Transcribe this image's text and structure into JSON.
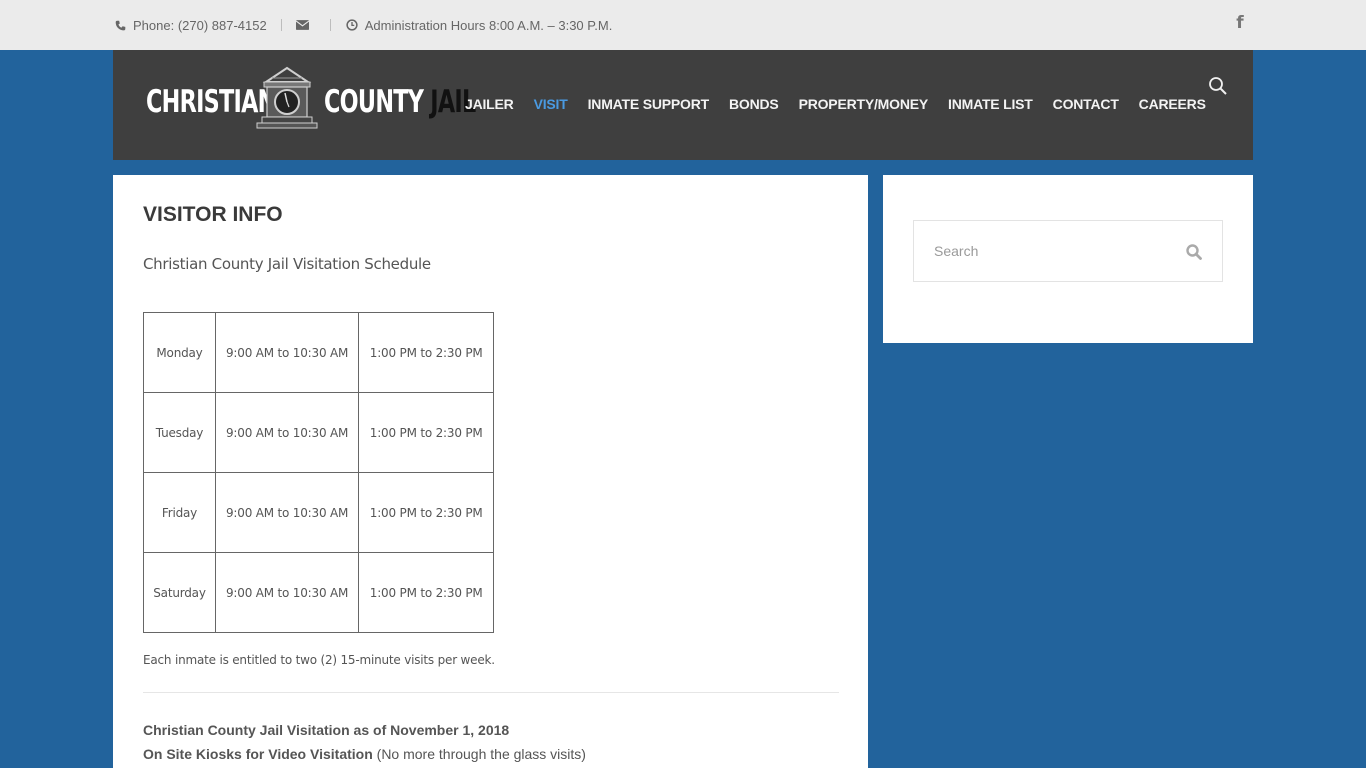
{
  "topbar": {
    "phone": "Phone: (270) 887-4152",
    "hours": "Administration Hours 8:00 A.M. – 3:30 P.M.",
    "icons": {
      "phone": "phone-icon",
      "email": "envelope-icon",
      "clock": "clock-icon",
      "social": "facebook-icon"
    },
    "facebook_glyph": "f"
  },
  "header": {
    "logo": {
      "left": "CHRISTIAN",
      "county": "COUNTY",
      "jail": "JAIL"
    },
    "nav": [
      {
        "label": "JAILER",
        "active": false
      },
      {
        "label": "VISIT",
        "active": true
      },
      {
        "label": "INMATE SUPPORT",
        "active": false
      },
      {
        "label": "BONDS",
        "active": false
      },
      {
        "label": "PROPERTY/MONEY",
        "active": false
      },
      {
        "label": "INMATE LIST",
        "active": false
      },
      {
        "label": "CONTACT",
        "active": false
      },
      {
        "label": "CAREERS",
        "active": false
      }
    ],
    "active_color": "#4a9ae1"
  },
  "main": {
    "title": "VISITOR INFO",
    "subtitle": "Christian County Jail Visitation Schedule",
    "schedule": [
      {
        "day": "Monday",
        "am": "9:00 AM to 10:30 AM",
        "pm": "1:00 PM to 2:30 PM"
      },
      {
        "day": "Tuesday",
        "am": "9:00 AM to 10:30 AM",
        "pm": "1:00 PM to 2:30 PM"
      },
      {
        "day": "Friday",
        "am": "9:00 AM to 10:30 AM",
        "pm": "1:00 PM to 2:30 PM"
      },
      {
        "day": "Saturday",
        "am": "9:00 AM to 10:30 AM",
        "pm": "1:00 PM to 2:30 PM"
      }
    ],
    "note": "Each inmate is entitled to two (2) 15-minute visits per week.",
    "para1": "Christian County Jail Visitation as of November 1, 2018",
    "para2_bold": "On Site Kiosks for Video Visitation",
    "para2_rest": " (No more through the glass visits)"
  },
  "sidebar": {
    "search_placeholder": "Search"
  },
  "colors": {
    "background": "#22639c",
    "header": "#3f3f3f",
    "topbar": "#ebebeb"
  }
}
